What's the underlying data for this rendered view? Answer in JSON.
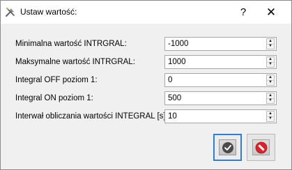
{
  "window": {
    "title": "Ustaw wartość:",
    "help_label": "?",
    "close_label": "✕"
  },
  "fields": [
    {
      "label": "Minimalna wartość  INTRGRAL:",
      "value": "-1000"
    },
    {
      "label": "Maksymalne wartość  INTRGRAL:",
      "value": "1000"
    },
    {
      "label": "Integral OFF poziom 1:",
      "value": "0"
    },
    {
      "label": "Integral ON poziom 1:",
      "value": "500"
    },
    {
      "label": "Interwał obliczania wartości INTEGRAL [s]:",
      "value": "10"
    }
  ],
  "icons": {
    "title": "tools-icon",
    "ok": "checkmark-icon",
    "cancel": "no-entry-icon"
  },
  "colors": {
    "focus_border": "#2f7fd1",
    "ok_icon": "#4a4a4a",
    "cancel_icon": "#d9252b"
  }
}
